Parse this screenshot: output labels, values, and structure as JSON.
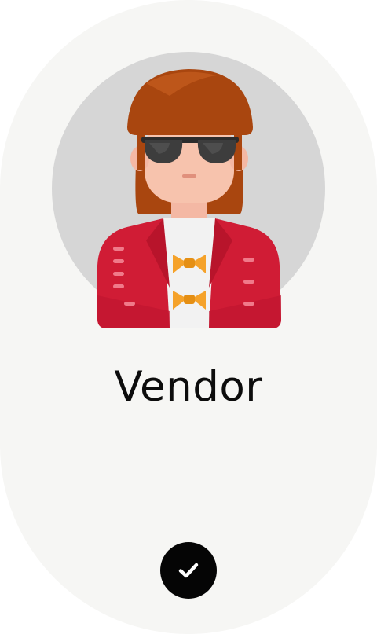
{
  "card": {
    "title": "Vendor",
    "selected": true
  },
  "avatar": {
    "icon": "vendor-person-avatar",
    "circle_color": "#d6d6d6"
  },
  "selection": {
    "icon": "checkmark-icon",
    "button_color": "#050505"
  },
  "colors": {
    "card_background": "#f6f6f4",
    "hair": "#a9460f",
    "jacket": "#d01c35",
    "bowtie": "#f5a22a"
  }
}
